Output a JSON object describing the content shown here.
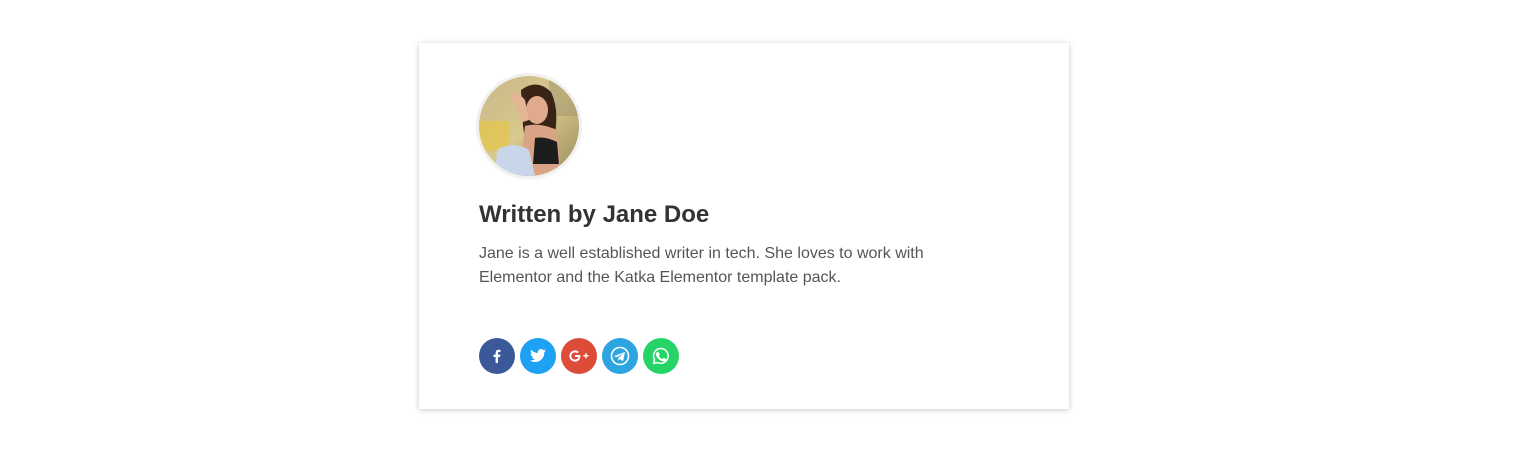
{
  "author": {
    "title": "Written by Jane Doe",
    "bio": "Jane is a well established writer in tech. She loves to work with Elementor and the Katka Elementor template pack."
  },
  "social": [
    {
      "icon": "facebook-icon",
      "color": "#3b5998"
    },
    {
      "icon": "twitter-icon",
      "color": "#1da1f2"
    },
    {
      "icon": "google-plus-icon",
      "color": "#dd4b39"
    },
    {
      "icon": "telegram-icon",
      "color": "#2ca5e0"
    },
    {
      "icon": "whatsapp-icon",
      "color": "#25d366"
    }
  ]
}
